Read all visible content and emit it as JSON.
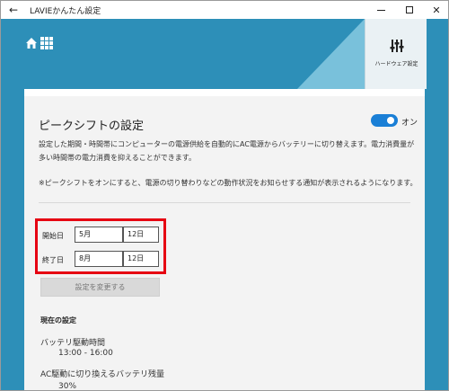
{
  "window": {
    "title": "LAVIEかんたん設定",
    "back_glyph": "←",
    "close_glyph": "✕"
  },
  "header": {
    "hardware_tile_label": "ハードウェア設定"
  },
  "peak_shift": {
    "title": "ピークシフトの設定",
    "toggle_label": "オン",
    "toggle_state": "on",
    "description": "設定した期間・時間帯にコンピューターの電源供給を自動的にAC電源からバッテリーに切り替えます。電力消費量が多い時間帯の電力消費を抑えることができます。",
    "note": "※ピークシフトをオンにすると、電源の切り替わりなどの動作状況をお知らせする通知が表示されるようになります。"
  },
  "dates": {
    "start_label": "開始日",
    "start_month": "5月",
    "start_day": "12日",
    "end_label": "終了日",
    "end_month": "8月",
    "end_day": "12日"
  },
  "change_button_label": "設定を変更する",
  "current": {
    "title": "現在の設定",
    "battery_label": "バッテリ駆動時間",
    "battery_value": "13:00 - 16:00",
    "ac_label": "AC駆動に切り換えるバッテリ残量",
    "ac_value": "30%"
  },
  "colors": {
    "header": "#2d8fb8",
    "triangle": "#79c1db",
    "toggle": "#1a7fd6",
    "highlight": "#e60012"
  }
}
